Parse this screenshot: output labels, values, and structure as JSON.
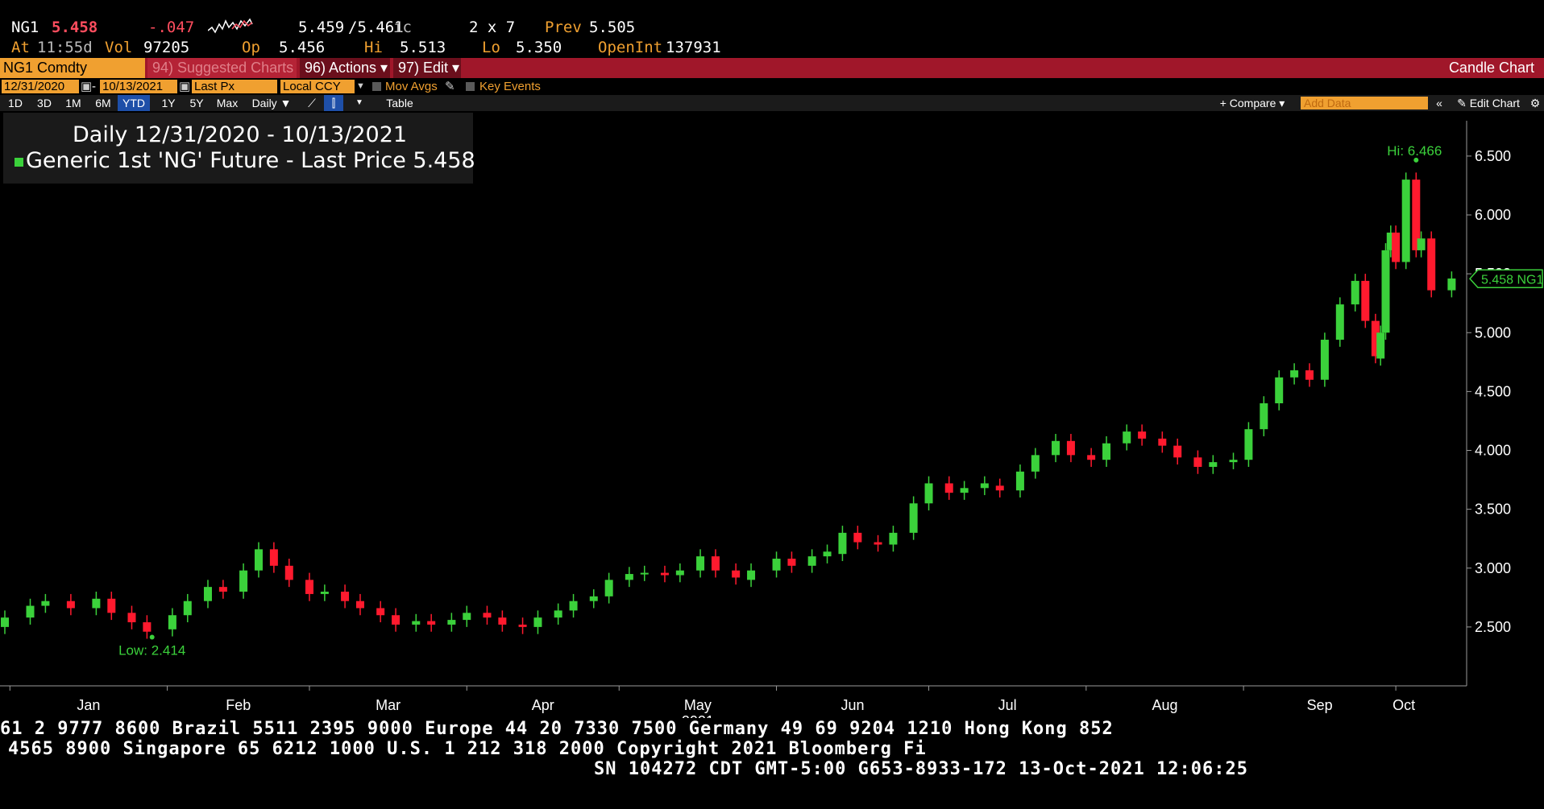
{
  "quote": {
    "ticker": "NG1",
    "last": "5.458",
    "change": "-.047",
    "bid_ask": "5.459",
    "ask": "/5.461",
    "ask_suffix": "ic",
    "size": "2 x 7",
    "prev_label": "Prev",
    "prev": "5.505",
    "at_label": "At",
    "time": "11:55d",
    "vol_label": "Vol",
    "vol": "97205",
    "op_label": "Op",
    "open": "5.456",
    "hi_label": "Hi",
    "high": "5.513",
    "lo_label": "Lo",
    "low": "5.350",
    "oi_label": "OpenInt",
    "open_interest": "137931"
  },
  "menubar": {
    "ticker_box": "NG1 Comdty",
    "suggested": "94) Suggested Charts",
    "actions": "96) Actions ▾",
    "edit": "97) Edit ▾",
    "chart_type": "Candle Chart"
  },
  "params": {
    "start_date": "12/31/2020",
    "end_date": "10/13/2021",
    "field": "Last Px",
    "currency": "Local CCY",
    "mov_avgs": "Mov Avgs",
    "key_events": "Key Events"
  },
  "toolbar": {
    "ranges": [
      "1D",
      "3D",
      "1M",
      "6M",
      "YTD",
      "1Y",
      "5Y",
      "Max"
    ],
    "selected_range": "YTD",
    "frequency": "Daily ▼",
    "table": "Table",
    "compare": "+ Compare ▾",
    "add_data_placeholder": "Add Data",
    "edit_chart": "Edit Chart"
  },
  "legend": {
    "title": "Daily 12/31/2020 - 10/13/2021",
    "series": "Generic 1st 'NG' Future - Last Price",
    "last_value": "5.458"
  },
  "colors": {
    "up": "#3bd13b",
    "down": "#ff1a2e",
    "accent": "#f0a030",
    "menubar": "#a0172a"
  },
  "footer": {
    "line1": "61 2 9777 8600 Brazil 5511 2395 9000 Europe 44 20 7330 7500 Germany 49 69 9204 1210 Hong Kong 852",
    "line2": "4565 8900       Singapore 65 6212 1000      U.S. 1 212 318 2000         Copyright 2021 Bloomberg Fi",
    "line3": "SN 104272 CDT  GMT-5:00 G653-8933-172 13-Oct-2021 12:06:25"
  },
  "chart_data": {
    "type": "candlestick",
    "title": "Daily 12/31/2020 - 10/13/2021",
    "series_name": "Generic 1st 'NG' Future - Last Price",
    "last_price_label": "5.458 NG1",
    "last_price": 5.458,
    "x_year_label": "2021",
    "x_ticks": [
      "Jan",
      "Feb",
      "Mar",
      "Apr",
      "May",
      "Jun",
      "Jul",
      "Aug",
      "Sep",
      "Oct"
    ],
    "ylim": [
      2.0,
      6.8
    ],
    "y_ticks": [
      2.5,
      3.0,
      3.5,
      4.0,
      4.5,
      5.0,
      5.5,
      6.0,
      6.5
    ],
    "y_tick_labels": [
      "2.500",
      "3.000",
      "3.500",
      "4.000",
      "4.500",
      "5.000",
      "5.500",
      "6.000",
      "6.500"
    ],
    "high_annotation": {
      "label": "Hi: 6.466",
      "value": 6.466,
      "date": "2021-10-05"
    },
    "low_annotation": {
      "label": "Low: 2.414",
      "value": 2.414,
      "date": "2021-01-29"
    },
    "candles": [
      {
        "d": "2020-12-31",
        "o": 2.5,
        "c": 2.58
      },
      {
        "d": "2021-01-05",
        "o": 2.58,
        "c": 2.68
      },
      {
        "d": "2021-01-08",
        "o": 2.68,
        "c": 2.72
      },
      {
        "d": "2021-01-13",
        "o": 2.72,
        "c": 2.66
      },
      {
        "d": "2021-01-18",
        "o": 2.66,
        "c": 2.74
      },
      {
        "d": "2021-01-21",
        "o": 2.74,
        "c": 2.62
      },
      {
        "d": "2021-01-25",
        "o": 2.62,
        "c": 2.54
      },
      {
        "d": "2021-01-28",
        "o": 2.54,
        "c": 2.46
      },
      {
        "d": "2021-02-02",
        "o": 2.48,
        "c": 2.6
      },
      {
        "d": "2021-02-05",
        "o": 2.6,
        "c": 2.72
      },
      {
        "d": "2021-02-09",
        "o": 2.72,
        "c": 2.84
      },
      {
        "d": "2021-02-12",
        "o": 2.84,
        "c": 2.8
      },
      {
        "d": "2021-02-16",
        "o": 2.8,
        "c": 2.98
      },
      {
        "d": "2021-02-19",
        "o": 2.98,
        "c": 3.16
      },
      {
        "d": "2021-02-22",
        "o": 3.16,
        "c": 3.02
      },
      {
        "d": "2021-02-25",
        "o": 3.02,
        "c": 2.9
      },
      {
        "d": "2021-03-01",
        "o": 2.9,
        "c": 2.78
      },
      {
        "d": "2021-03-04",
        "o": 2.78,
        "c": 2.8
      },
      {
        "d": "2021-03-08",
        "o": 2.8,
        "c": 2.72
      },
      {
        "d": "2021-03-11",
        "o": 2.72,
        "c": 2.66
      },
      {
        "d": "2021-03-15",
        "o": 2.66,
        "c": 2.6
      },
      {
        "d": "2021-03-18",
        "o": 2.6,
        "c": 2.52
      },
      {
        "d": "2021-03-22",
        "o": 2.52,
        "c": 2.55
      },
      {
        "d": "2021-03-25",
        "o": 2.55,
        "c": 2.52
      },
      {
        "d": "2021-03-29",
        "o": 2.52,
        "c": 2.56
      },
      {
        "d": "2021-04-01",
        "o": 2.56,
        "c": 2.62
      },
      {
        "d": "2021-04-05",
        "o": 2.62,
        "c": 2.58
      },
      {
        "d": "2021-04-08",
        "o": 2.58,
        "c": 2.52
      },
      {
        "d": "2021-04-12",
        "o": 2.52,
        "c": 2.5
      },
      {
        "d": "2021-04-15",
        "o": 2.5,
        "c": 2.58
      },
      {
        "d": "2021-04-19",
        "o": 2.58,
        "c": 2.64
      },
      {
        "d": "2021-04-22",
        "o": 2.64,
        "c": 2.72
      },
      {
        "d": "2021-04-26",
        "o": 2.72,
        "c": 2.76
      },
      {
        "d": "2021-04-29",
        "o": 2.76,
        "c": 2.9
      },
      {
        "d": "2021-05-03",
        "o": 2.9,
        "c": 2.95
      },
      {
        "d": "2021-05-06",
        "o": 2.95,
        "c": 2.96
      },
      {
        "d": "2021-05-10",
        "o": 2.96,
        "c": 2.94
      },
      {
        "d": "2021-05-13",
        "o": 2.94,
        "c": 2.98
      },
      {
        "d": "2021-05-17",
        "o": 2.98,
        "c": 3.1
      },
      {
        "d": "2021-05-20",
        "o": 3.1,
        "c": 2.98
      },
      {
        "d": "2021-05-24",
        "o": 2.98,
        "c": 2.92
      },
      {
        "d": "2021-05-27",
        "o": 2.9,
        "c": 2.98
      },
      {
        "d": "2021-06-01",
        "o": 2.98,
        "c": 3.08
      },
      {
        "d": "2021-06-04",
        "o": 3.08,
        "c": 3.02
      },
      {
        "d": "2021-06-08",
        "o": 3.02,
        "c": 3.1
      },
      {
        "d": "2021-06-11",
        "o": 3.1,
        "c": 3.14
      },
      {
        "d": "2021-06-14",
        "o": 3.12,
        "c": 3.3
      },
      {
        "d": "2021-06-17",
        "o": 3.3,
        "c": 3.22
      },
      {
        "d": "2021-06-21",
        "o": 3.22,
        "c": 3.2
      },
      {
        "d": "2021-06-24",
        "o": 3.2,
        "c": 3.3
      },
      {
        "d": "2021-06-28",
        "o": 3.3,
        "c": 3.55
      },
      {
        "d": "2021-07-01",
        "o": 3.55,
        "c": 3.72
      },
      {
        "d": "2021-07-05",
        "o": 3.72,
        "c": 3.64
      },
      {
        "d": "2021-07-08",
        "o": 3.64,
        "c": 3.68
      },
      {
        "d": "2021-07-12",
        "o": 3.68,
        "c": 3.72
      },
      {
        "d": "2021-07-15",
        "o": 3.7,
        "c": 3.66
      },
      {
        "d": "2021-07-19",
        "o": 3.66,
        "c": 3.82
      },
      {
        "d": "2021-07-22",
        "o": 3.82,
        "c": 3.96
      },
      {
        "d": "2021-07-26",
        "o": 3.96,
        "c": 4.08
      },
      {
        "d": "2021-07-29",
        "o": 4.08,
        "c": 3.96
      },
      {
        "d": "2021-08-02",
        "o": 3.96,
        "c": 3.92
      },
      {
        "d": "2021-08-05",
        "o": 3.92,
        "c": 4.06
      },
      {
        "d": "2021-08-09",
        "o": 4.06,
        "c": 4.16
      },
      {
        "d": "2021-08-12",
        "o": 4.16,
        "c": 4.1
      },
      {
        "d": "2021-08-16",
        "o": 4.1,
        "c": 4.04
      },
      {
        "d": "2021-08-19",
        "o": 4.04,
        "c": 3.94
      },
      {
        "d": "2021-08-23",
        "o": 3.94,
        "c": 3.86
      },
      {
        "d": "2021-08-26",
        "o": 3.86,
        "c": 3.9
      },
      {
        "d": "2021-08-30",
        "o": 3.9,
        "c": 3.92
      },
      {
        "d": "2021-09-02",
        "o": 3.92,
        "c": 4.18
      },
      {
        "d": "2021-09-05",
        "o": 4.18,
        "c": 4.4
      },
      {
        "d": "2021-09-08",
        "o": 4.4,
        "c": 4.62
      },
      {
        "d": "2021-09-11",
        "o": 4.62,
        "c": 4.68
      },
      {
        "d": "2021-09-14",
        "o": 4.68,
        "c": 4.6
      },
      {
        "d": "2021-09-17",
        "o": 4.6,
        "c": 4.94
      },
      {
        "d": "2021-09-20",
        "o": 4.94,
        "c": 5.24
      },
      {
        "d": "2021-09-23",
        "o": 5.24,
        "c": 5.44
      },
      {
        "d": "2021-09-25",
        "o": 5.44,
        "c": 5.1
      },
      {
        "d": "2021-09-27",
        "o": 5.1,
        "c": 4.8
      },
      {
        "d": "2021-09-28",
        "o": 4.78,
        "c": 5.0
      },
      {
        "d": "2021-09-29",
        "o": 5.0,
        "c": 5.7
      },
      {
        "d": "2021-09-30",
        "o": 5.7,
        "c": 5.85
      },
      {
        "d": "2021-10-01",
        "o": 5.85,
        "c": 5.6
      },
      {
        "d": "2021-10-03",
        "o": 5.6,
        "c": 6.3
      },
      {
        "d": "2021-10-05",
        "o": 6.3,
        "c": 5.7
      },
      {
        "d": "2021-10-06",
        "o": 5.7,
        "c": 5.8
      },
      {
        "d": "2021-10-08",
        "o": 5.8,
        "c": 5.36
      },
      {
        "d": "2021-10-12",
        "o": 5.36,
        "c": 5.46
      }
    ]
  }
}
